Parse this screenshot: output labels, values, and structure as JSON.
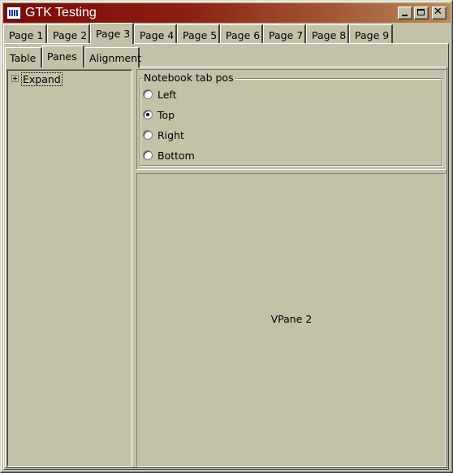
{
  "window": {
    "title": "GTK Testing",
    "icon": "gtk-app-icon",
    "controls": {
      "minimize": "minimize-icon",
      "maximize": "maximize-icon",
      "close": "close-icon"
    }
  },
  "tabs": [
    {
      "label": "Page 1",
      "active": false
    },
    {
      "label": "Page 2",
      "active": false
    },
    {
      "label": "Page 3",
      "active": true
    },
    {
      "label": "Page 4",
      "active": false
    },
    {
      "label": "Page 5",
      "active": false
    },
    {
      "label": "Page 6",
      "active": false
    },
    {
      "label": "Page 7",
      "active": false
    },
    {
      "label": "Page 8",
      "active": false
    },
    {
      "label": "Page 9",
      "active": false
    }
  ],
  "subtabs": [
    {
      "label": "Table",
      "active": false
    },
    {
      "label": "Panes",
      "active": true
    },
    {
      "label": "Alignment",
      "active": false
    }
  ],
  "tree": {
    "expand_label": "Expand"
  },
  "notebook_tab_pos": {
    "legend": "Notebook tab pos",
    "options": [
      {
        "label": "Left",
        "checked": false
      },
      {
        "label": "Top",
        "checked": true
      },
      {
        "label": "Right",
        "checked": false
      },
      {
        "label": "Bottom",
        "checked": false
      }
    ]
  },
  "vpane2": {
    "label": "VPane 2"
  },
  "colors": {
    "background": "#c4c1a9",
    "title_start": "#7b0a0a",
    "title_end": "#b98a5b"
  }
}
